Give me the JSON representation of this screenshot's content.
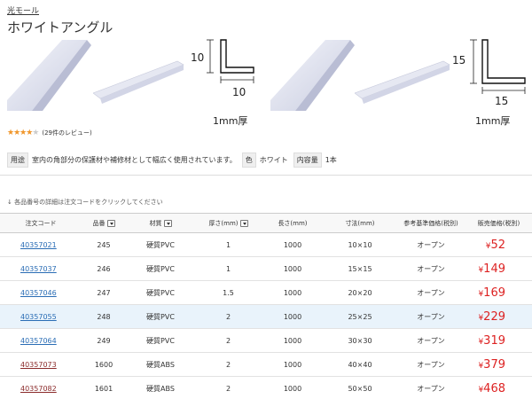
{
  "breadcrumb": "光モール",
  "title": "ホワイトアングル",
  "products": [
    {
      "dim_h": "10",
      "dim_w": "10",
      "thickness": "1mm厚"
    },
    {
      "dim_h": "15",
      "dim_w": "15",
      "thickness": "1mm厚"
    }
  ],
  "rating": {
    "stars": 4,
    "max": 5,
    "reviews": "(29件のレビュー)"
  },
  "attributes": {
    "use_tag": "用途",
    "use_value": "室内の角部分の保護材や補修材として幅広く使用されています。",
    "color_tag": "色",
    "color_value": "ホワイト",
    "qty_tag": "内容量",
    "qty_value": "1本"
  },
  "note": "各品番号の詳細は注文コードをクリックしてください",
  "table": {
    "headers": [
      "注文コード",
      "品番",
      "材質",
      "厚さ(mm)",
      "長さ(mm)",
      "寸法(mm)",
      "参考基準価格(税別)",
      "販売価格(税別)"
    ],
    "rows": [
      {
        "code": "40357021",
        "num": "245",
        "material": "硬質PVC",
        "thick": "1",
        "length": "1000",
        "size": "10×10",
        "ref": "オープン",
        "price": "52",
        "visited": false,
        "hl": false
      },
      {
        "code": "40357037",
        "num": "246",
        "material": "硬質PVC",
        "thick": "1",
        "length": "1000",
        "size": "15×15",
        "ref": "オープン",
        "price": "149",
        "visited": false,
        "hl": false
      },
      {
        "code": "40357046",
        "num": "247",
        "material": "硬質PVC",
        "thick": "1.5",
        "length": "1000",
        "size": "20×20",
        "ref": "オープン",
        "price": "169",
        "visited": false,
        "hl": false
      },
      {
        "code": "40357055",
        "num": "248",
        "material": "硬質PVC",
        "thick": "2",
        "length": "1000",
        "size": "25×25",
        "ref": "オープン",
        "price": "229",
        "visited": false,
        "hl": true
      },
      {
        "code": "40357064",
        "num": "249",
        "material": "硬質PVC",
        "thick": "2",
        "length": "1000",
        "size": "30×30",
        "ref": "オープン",
        "price": "319",
        "visited": false,
        "hl": false
      },
      {
        "code": "40357073",
        "num": "1600",
        "material": "硬質ABS",
        "thick": "2",
        "length": "1000",
        "size": "40×40",
        "ref": "オープン",
        "price": "379",
        "visited": true,
        "hl": false
      },
      {
        "code": "40357082",
        "num": "1601",
        "material": "硬質ABS",
        "thick": "2",
        "length": "1000",
        "size": "50×50",
        "ref": "オープン",
        "price": "468",
        "visited": true,
        "hl": false
      }
    ]
  },
  "currency": "¥",
  "colors": {
    "price": "#dd2222",
    "link": "#2a6db5",
    "visited_link": "#8b2b2b",
    "star": "#f0962a",
    "highlight_row": "#e9f3fb"
  }
}
